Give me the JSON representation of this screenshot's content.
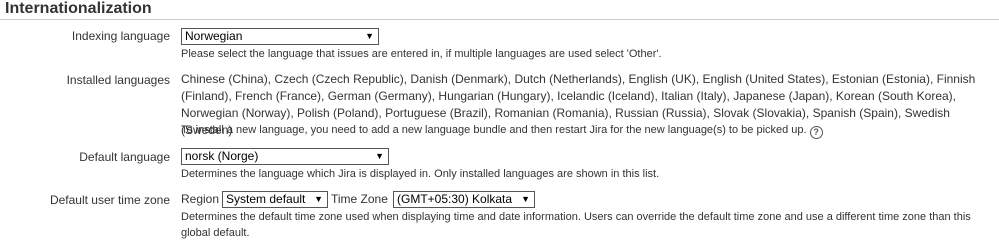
{
  "section": {
    "title": "Internationalization"
  },
  "indexing": {
    "label": "Indexing language",
    "selected": "Norwegian",
    "description": "Please select the language that issues are entered in, if multiple languages are used select 'Other'."
  },
  "installed": {
    "label": "Installed languages",
    "list": "Chinese (China), Czech (Czech Republic), Danish (Denmark), Dutch (Netherlands), English (UK), English (United States), Estonian (Estonia), Finnish (Finland), French (France), German (Germany), Hungarian (Hungary), Icelandic (Iceland), Italian (Italy), Japanese (Japan), Korean (South Korea), Norwegian (Norway), Polish (Poland), Portuguese (Brazil), Romanian (Romania), Russian (Russia), Slovak (Slovakia), Spanish (Spain), Swedish (Sweden)",
    "note": "To install a new language, you need to add a new language bundle and then restart Jira for the new language(s) to be picked up.",
    "help_icon": "?"
  },
  "default_language": {
    "label": "Default language",
    "selected": "norsk (Norge)",
    "description": "Determines the language which Jira is displayed in. Only installed languages are shown in this list."
  },
  "timezone": {
    "label": "Default user time zone",
    "region_label": "Region",
    "region_selected": "System default",
    "zone_label": "Time Zone",
    "zone_selected": "(GMT+05:30) Kolkata",
    "description": "Determines the default time zone used when displaying time and date information. Users can override the default time zone and use a different time zone than this global default."
  },
  "icons": {
    "dropdown_arrow": "▼"
  }
}
